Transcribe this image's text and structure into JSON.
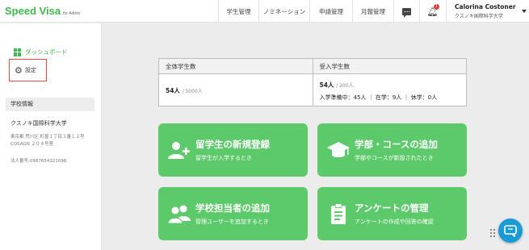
{
  "header": {
    "logo": "Speed Visa",
    "logo_sub": "for Admin",
    "nav": [
      {
        "label": "学生管理"
      },
      {
        "label": "ノミネーション"
      },
      {
        "label": "申請管理"
      },
      {
        "label": "月報管理"
      }
    ],
    "notification_count": "1",
    "user": {
      "name": "Calorina Costoner",
      "org": "クスノキ国際科学大学"
    }
  },
  "sidebar": {
    "dashboard": "ダッシュボード",
    "settings": "設定",
    "section_title": "学校情報",
    "school_name": "クスノキ国際科学大学",
    "address": "東京都 荒川区 町屋１丁目３番１２号 COSAGN ２０４号室",
    "corp_number": "法人番号:0987654321098"
  },
  "stats": {
    "total": {
      "title": "全体学生数",
      "value": "54人",
      "capacity": "/ 5000人"
    },
    "accepted": {
      "title": "受入学生数",
      "value": "54人",
      "capacity": "/ 200人",
      "detail": "入学準備中：45人 ｜ 在学：9人 ｜ 休学：0人"
    }
  },
  "cards": [
    {
      "title": "留学生の新規登録",
      "subtitle": "留学生が入学するとき",
      "icon": "user-plus-icon"
    },
    {
      "title": "学部・コースの追加",
      "subtitle": "学部やコースが新設されたとき",
      "icon": "graduation-cap-icon"
    },
    {
      "title": "学校担当者の追加",
      "subtitle": "管理ユーザーを追加するとき",
      "icon": "users-icon"
    },
    {
      "title": "アンケートの管理",
      "subtitle": "アンケートの作成や回答の確認",
      "icon": "clipboard-icon"
    }
  ],
  "colors": {
    "brand": "#3fb84f",
    "card": "#5cc96a",
    "fab": "#1a9ad6",
    "highlight": "#e54b3c"
  }
}
